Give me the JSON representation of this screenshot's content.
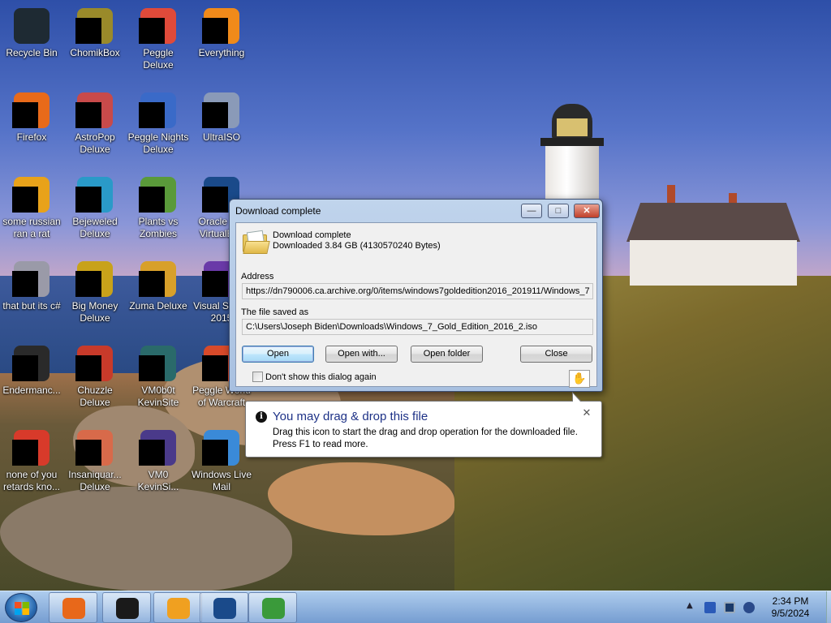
{
  "desktop_icons": [
    {
      "label": "Recycle Bin",
      "icon": "recycle-bin-icon",
      "color": "#1e2a33",
      "censored": false
    },
    {
      "label": "ChomikBox",
      "icon": "chomikbox-icon",
      "color": "#9a8a2a",
      "censored": true
    },
    {
      "label": "Peggle Deluxe",
      "icon": "peggle-deluxe-icon",
      "color": "#e04a3a",
      "censored": true
    },
    {
      "label": "Everything",
      "icon": "everything-icon",
      "color": "#f08a1a",
      "censored": true
    },
    {
      "label": "Firefox",
      "icon": "firefox-icon",
      "color": "#e86a1a",
      "censored": true
    },
    {
      "label": "AstroPop Deluxe",
      "icon": "astropop-icon",
      "color": "#c84a4a",
      "censored": true
    },
    {
      "label": "Peggle Nights Deluxe",
      "icon": "peggle-nights-icon",
      "color": "#3a6ac8",
      "censored": true
    },
    {
      "label": "UltraISO",
      "icon": "ultraiso-icon",
      "color": "#8a9ab8",
      "censored": true
    },
    {
      "label": "some russian ran a rat",
      "icon": "russian-rat-icon",
      "color": "#e8a21a",
      "censored": true
    },
    {
      "label": "Bejeweled Deluxe",
      "icon": "bejeweled-icon",
      "color": "#2a9ac8",
      "censored": true
    },
    {
      "label": "Plants vs Zombies",
      "icon": "plants-vs-zombies-icon",
      "color": "#5a9a3a",
      "censored": true
    },
    {
      "label": "Oracle VM VirtualBox",
      "icon": "virtualbox-icon",
      "color": "#1a4a8a",
      "censored": true
    },
    {
      "label": "that but its c#",
      "icon": "csharp-file-icon",
      "color": "#9a9aa8",
      "censored": true
    },
    {
      "label": "Big Money Deluxe",
      "icon": "big-money-icon",
      "color": "#c8a21a",
      "censored": true
    },
    {
      "label": "Zuma Deluxe",
      "icon": "zuma-icon",
      "color": "#d8a02a",
      "censored": true
    },
    {
      "label": "Visual Studio 2015",
      "icon": "visual-studio-icon",
      "color": "#6a3aa8",
      "censored": true
    },
    {
      "label": "Endermanc...",
      "icon": "endermanch-icon",
      "color": "#2a2a2a",
      "censored": true
    },
    {
      "label": "Chuzzle Deluxe",
      "icon": "chuzzle-icon",
      "color": "#c83a2a",
      "censored": true
    },
    {
      "label": "VM0b0t KevinSite",
      "icon": "vm0b0t-icon",
      "color": "#2a6a6a",
      "censored": true
    },
    {
      "label": "Peggle World of Warcraft",
      "icon": "peggle-wow-icon",
      "color": "#d84a2a",
      "censored": true
    },
    {
      "label": "none of you retards kno...",
      "icon": "chrome-shortcut-icon",
      "color": "#d83a2a",
      "censored": true
    },
    {
      "label": "Insaniquar... Deluxe",
      "icon": "insaniquarium-icon",
      "color": "#d86a4a",
      "censored": true
    },
    {
      "label": "VM0 KevinSi...",
      "icon": "vm0-icon",
      "color": "#4a3a8a",
      "censored": true
    },
    {
      "label": "Windows Live Mail",
      "icon": "windows-live-mail-icon",
      "color": "#3a8ad8",
      "censored": true
    }
  ],
  "dialog": {
    "title": "Download complete",
    "heading": "Download complete",
    "downloaded_info": "Downloaded  3.84  GB (4130570240 Bytes)",
    "address_label": "Address",
    "address_value": "https://dn790006.ca.archive.org/0/items/windows7goldedition2016_201911/Windows_7",
    "saved_label": "The file saved as",
    "saved_value": "C:\\Users\\Joseph Biden\\Downloads\\Windows_7_Gold_Edition_2016_2.iso",
    "buttons": {
      "open": "Open",
      "open_with": "Open with...",
      "open_folder": "Open folder",
      "close": "Close"
    },
    "checkbox_label": "Don't show this dialog again",
    "checkbox_checked": false,
    "caption": {
      "minimize": "—",
      "maximize": "□",
      "close": "✕"
    }
  },
  "balloon": {
    "title": "You may drag & drop this file",
    "body": "Drag this icon to start the drag and drop operation for the downloaded file. Press F1 to read more.",
    "icon_glyph": "i",
    "close_glyph": "✕"
  },
  "taskbar": {
    "pinned": [
      {
        "icon": "firefox-taskbar-icon",
        "color": "#e8681a"
      },
      {
        "icon": "console-taskbar-icon",
        "color": "#1a1a1a"
      },
      {
        "icon": "media-player-taskbar-icon",
        "color": "#f0a020"
      },
      {
        "icon": "virtualbox-taskbar-icon",
        "color": "#1a4a8a"
      },
      {
        "icon": "idm-taskbar-icon",
        "color": "#3a9a3a"
      }
    ],
    "tray": {
      "expand_glyph": "▲"
    },
    "clock": {
      "time": "2:34 PM",
      "date": "9/5/2024"
    }
  }
}
